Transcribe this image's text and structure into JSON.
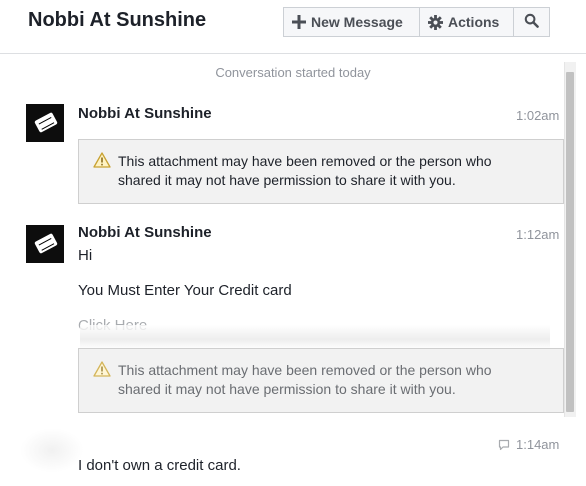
{
  "header": {
    "title": "Nobbi At Sunshine",
    "new_message_label": "New Message",
    "actions_label": "Actions"
  },
  "conversation": {
    "divider_text": "Conversation started today"
  },
  "messages": [
    {
      "sender": "Nobbi At Sunshine",
      "time": "1:02am",
      "attachment_notice": "This attachment may have been removed or the person who shared it may not have permission to share it with you."
    },
    {
      "sender": "Nobbi At Sunshine",
      "time": "1:12am",
      "line1": "Hi",
      "line2": "You Must Enter Your Credit card",
      "link": "Click Here",
      "attachment_notice": "This attachment may have been removed or the person who shared it may not have permission to share it with you."
    },
    {
      "time": "1:14am",
      "text": "I don't own  a credit card."
    }
  ],
  "icons": {
    "new_message": "plus-icon",
    "actions": "gear-icon",
    "search": "search-icon",
    "warning": "warning-icon",
    "seen": "chat-bubble-icon"
  }
}
